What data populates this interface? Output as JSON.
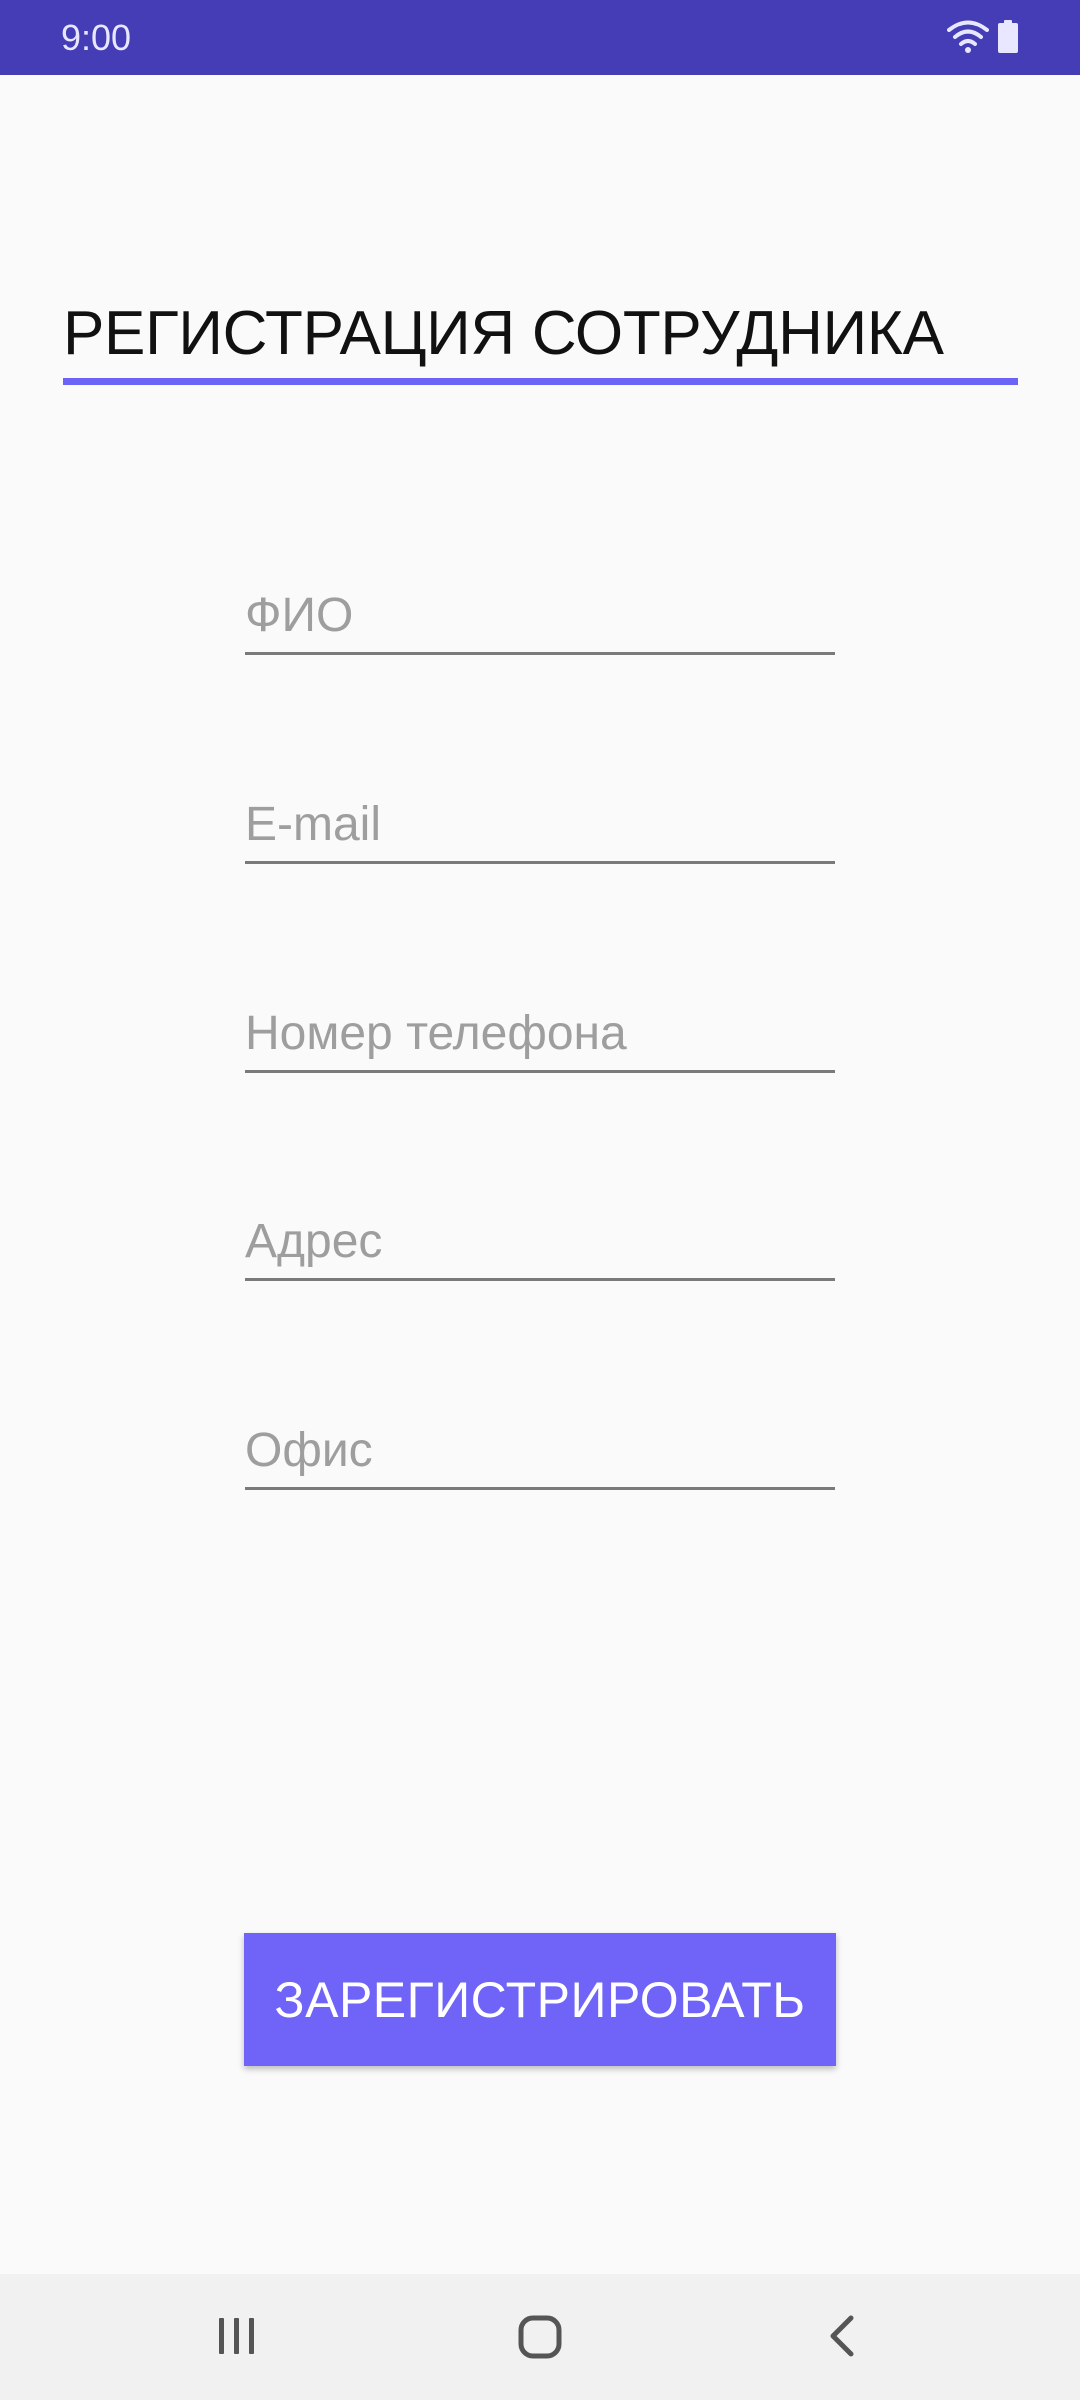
{
  "status_bar": {
    "time": "9:00",
    "icons": [
      "wifi-icon",
      "battery-icon"
    ],
    "background": "#443db5"
  },
  "header": {
    "title": "РЕГИСТРАЦИЯ СОТРУДНИКА",
    "accent_color": "#6c63f6"
  },
  "form": {
    "full_name": {
      "placeholder": "ФИО",
      "value": ""
    },
    "email": {
      "placeholder": "E-mail",
      "value": ""
    },
    "phone": {
      "placeholder": "Номер телефона",
      "value": ""
    },
    "address": {
      "placeholder": "Адрес",
      "value": ""
    },
    "office": {
      "placeholder": "Офис",
      "value": ""
    }
  },
  "actions": {
    "register_label": "ЗАРЕГИСТРИРОВАТЬ",
    "button_color": "#6f64f7"
  },
  "nav_bar": {
    "items": [
      "recent-apps-icon",
      "home-icon",
      "back-icon"
    ]
  }
}
